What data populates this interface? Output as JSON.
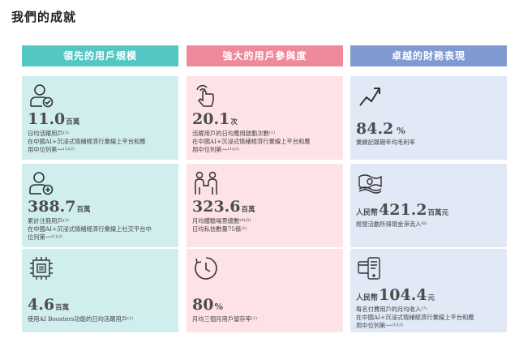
{
  "page": {
    "title": "我們的成就"
  },
  "columns": [
    {
      "heading": "領先的用戶規模",
      "cards": [
        {
          "icon": "user-check-icon",
          "value": "11.0",
          "unit": "百萬",
          "lines": [
            "日均活躍用戶",
            "在中國AI+沉浸式情緒經濟行業線上平台和應",
            "用中位列第一"
          ],
          "sups": [
            "(1)",
            "(1)(2)"
          ]
        },
        {
          "icon": "user-add-icon",
          "value": "388.7",
          "unit": "百萬",
          "lines": [
            "累計注冊用戶",
            "在中國AI+沉浸式情緒經濟行業線上社交平台中",
            "位列第一"
          ],
          "sups": [
            "(3)",
            "(1)(2)"
          ]
        },
        {
          "icon": "ai-chip-icon",
          "value": "4.6",
          "unit": "百萬",
          "lines": [
            "使用AI Boosters功能的日均活躍用戶"
          ],
          "sups": [
            "(1)"
          ]
        }
      ]
    },
    {
      "heading": "強大的用戶參與度",
      "cards": [
        {
          "icon": "tap-gesture-icon",
          "value": "20.1",
          "unit": "次",
          "lines": [
            "活躍用戶的日均應用啟動次數",
            "在中國AI+沉浸式情緒經濟行業線上平台和應",
            "用中位列第一"
          ],
          "sups": [
            "(1)",
            "(1)(2)"
          ]
        },
        {
          "icon": "people-interaction-icon",
          "value": "323.6",
          "unit": "百萬",
          "lines": [
            "月均體驗場景總數",
            "日均私信數量75條"
          ],
          "sups": [
            "(4)(5)",
            "(1)"
          ]
        },
        {
          "icon": "clock-icon",
          "value": "80",
          "unit": "%",
          "lines": [
            "月均三個月用戶留存率"
          ],
          "sups": [
            "(1)"
          ]
        }
      ]
    },
    {
      "heading": "卓越的財務表現",
      "cards": [
        {
          "icon": "trend-up-icon",
          "value": "84.2",
          "unit": "%",
          "lines": [
            "業績記錄期年均毛利率"
          ],
          "sups": []
        },
        {
          "icon": "money-stack-icon",
          "prefix": "人民幣",
          "value": "421.2",
          "unit": "百萬元",
          "lines": [
            "經營活動所得現金淨流入"
          ],
          "sups": [
            "(6)"
          ]
        },
        {
          "icon": "payment-card-icon",
          "prefix": "人民幣",
          "value": "104.4",
          "unit": "元",
          "lines": [
            "每名付費用戶的月均收入",
            "在中國AI+沉浸式情緒經濟行業線上平台和應",
            "用中位列第一"
          ],
          "sups": [
            "(7)",
            "(1)(2)"
          ]
        }
      ]
    }
  ]
}
